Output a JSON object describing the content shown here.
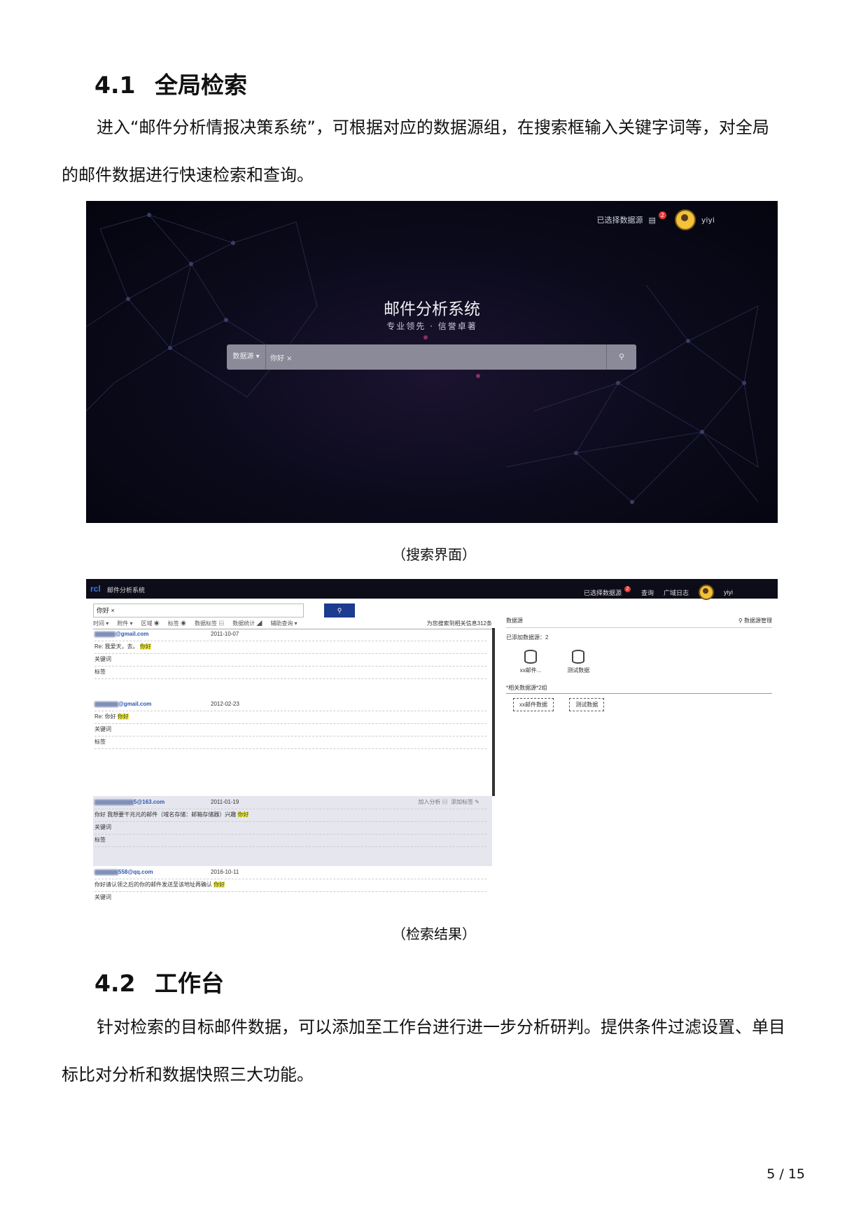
{
  "section1": {
    "number": "4.1",
    "title": "全局检索",
    "para_first": "进入“邮件分析情报决策系统”，可根据对应的数据源组，在搜索框输入关键字词等，对全局",
    "para_rest": "的邮件数据进行快速检索和查询。"
  },
  "search_screen": {
    "top_link": "已选择数据源",
    "badge": "2",
    "user": "yiyi",
    "title": "邮件分析系统",
    "subtitle": "专业领先 · 信誉卓著",
    "datasource_label": "数据源",
    "query": "你好",
    "caption": "（搜索界面）"
  },
  "results_screen": {
    "logo": "rcl",
    "app_name": "邮件分析系统",
    "topnav": [
      "已选择数据源",
      "查询",
      "广域日志"
    ],
    "badge": "2",
    "user": "yiyi",
    "query": "你好",
    "filters": [
      "时间 ▾",
      "附件 ▾",
      "区域 ◉",
      "标签 ◉",
      "数据标签 ▤",
      "数据统计 ◢",
      "辅助查询 ▾"
    ],
    "count_text": "为您搜索到相关信息312条",
    "action_add": "加入分析 ▤",
    "action_tag": "添加标签 ✎",
    "row_keyword_label": "关键词",
    "row_tag_label": "标签",
    "results": [
      {
        "email": "@gmail.com",
        "date": "2011-10-07",
        "subject_pre": "Re: 我爱天，去。",
        "subject_mark": "你好",
        "kw_label": "关键词"
      },
      {
        "email": "@gmail.com",
        "date": "2012-02-23",
        "subject_pre": "Re: 你好",
        "subject_mark": "你好",
        "kw_label": "关键词"
      },
      {
        "email": "5@163.com",
        "date": "2011-01-19",
        "subject_pre": "你好 我想要干兆元的邮件（域名存储：邮箱存储器）兴趣",
        "subject_mark": "你好",
        "kw_label": "关键词"
      },
      {
        "email": "558@qq.com",
        "date": "2016-10-11",
        "subject_pre": "你好请认领之后的你的邮件发送至该地址再确认",
        "subject_mark": "你好",
        "kw_label": "关键词"
      }
    ],
    "side": {
      "title": "数据源",
      "manage": "数据源管理",
      "added_label": "已添加数据源：2",
      "sources": [
        "xx邮件...",
        "测试数据"
      ],
      "related_label": "*相关数据源*2组",
      "related": [
        "xx邮件数据",
        "测试数据"
      ]
    },
    "caption": "（检索结果）"
  },
  "section2": {
    "number": "4.2",
    "title": "工作台",
    "para_first": "针对检索的目标邮件数据，可以添加至工作台进行进一步分析研判。提供条件过滤设置、单目",
    "para_rest": "标比对分析和数据快照三大功能。"
  },
  "page_number": "5 / 15"
}
